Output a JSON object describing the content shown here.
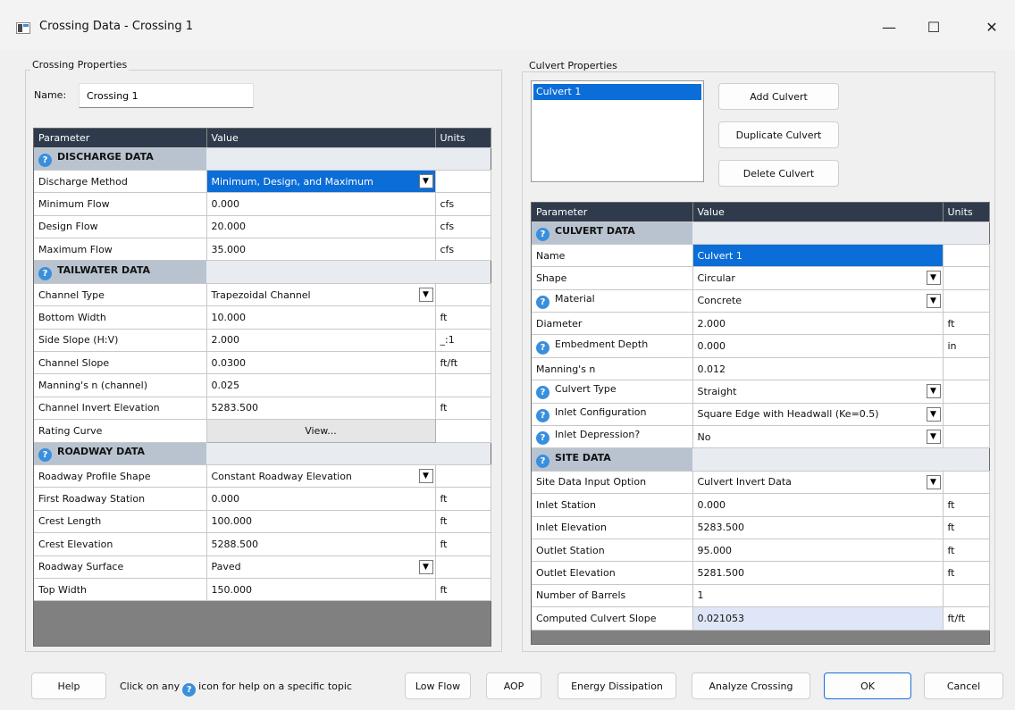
{
  "window": {
    "title": "Crossing Data - Crossing 1"
  },
  "crossing": {
    "group_label": "Crossing Properties",
    "name_label": "Name:",
    "name_value": "Crossing 1",
    "headers": [
      "Parameter",
      "Value",
      "Units"
    ],
    "sections": [
      {
        "title": "DISCHARGE DATA",
        "rows": [
          {
            "param": "Discharge Method",
            "value": "Minimum, Design, and Maximum",
            "units": ""
          },
          {
            "param": "Minimum Flow",
            "value": "0.000",
            "units": "cfs"
          },
          {
            "param": "Design Flow",
            "value": "20.000",
            "units": "cfs"
          },
          {
            "param": "Maximum Flow",
            "value": "35.000",
            "units": "cfs"
          }
        ]
      },
      {
        "title": "TAILWATER DATA",
        "rows": [
          {
            "param": "Channel Type",
            "value": "Trapezoidal Channel",
            "units": ""
          },
          {
            "param": "Bottom Width",
            "value": "10.000",
            "units": "ft"
          },
          {
            "param": "Side Slope (H:V)",
            "value": "2.000",
            "units": "_:1"
          },
          {
            "param": "Channel Slope",
            "value": "0.0300",
            "units": "ft/ft"
          },
          {
            "param": "Manning's n (channel)",
            "value": "0.025",
            "units": ""
          },
          {
            "param": "Channel Invert Elevation",
            "value": "5283.500",
            "units": "ft"
          },
          {
            "param": "Rating Curve",
            "value": "View...",
            "units": ""
          }
        ]
      },
      {
        "title": "ROADWAY DATA",
        "rows": [
          {
            "param": "Roadway Profile Shape",
            "value": "Constant Roadway Elevation",
            "units": ""
          },
          {
            "param": "First Roadway Station",
            "value": "0.000",
            "units": "ft"
          },
          {
            "param": "Crest Length",
            "value": "100.000",
            "units": "ft"
          },
          {
            "param": "Crest Elevation",
            "value": "5288.500",
            "units": "ft"
          },
          {
            "param": "Roadway Surface",
            "value": "Paved",
            "units": ""
          },
          {
            "param": "Top Width",
            "value": "150.000",
            "units": "ft"
          }
        ]
      }
    ]
  },
  "culvert": {
    "group_label": "Culvert Properties",
    "list": [
      "Culvert 1"
    ],
    "buttons": {
      "add": "Add Culvert",
      "duplicate": "Duplicate Culvert",
      "delete": "Delete Culvert"
    },
    "headers": [
      "Parameter",
      "Value",
      "Units"
    ],
    "sections": [
      {
        "title": "CULVERT DATA",
        "rows": [
          {
            "param": "Name",
            "value": "Culvert 1",
            "units": ""
          },
          {
            "param": "Shape",
            "value": "Circular",
            "units": ""
          },
          {
            "param": "Material",
            "value": "Concrete",
            "units": ""
          },
          {
            "param": "Diameter",
            "value": "2.000",
            "units": "ft"
          },
          {
            "param": "Embedment Depth",
            "value": "0.000",
            "units": "in"
          },
          {
            "param": "Manning's n",
            "value": "0.012",
            "units": ""
          },
          {
            "param": "Culvert Type",
            "value": "Straight",
            "units": ""
          },
          {
            "param": "Inlet Configuration",
            "value": "Square Edge with Headwall (Ke=0.5)",
            "units": ""
          },
          {
            "param": "Inlet Depression?",
            "value": "No",
            "units": ""
          }
        ]
      },
      {
        "title": "SITE DATA",
        "rows": [
          {
            "param": "Site Data Input Option",
            "value": "Culvert Invert Data",
            "units": ""
          },
          {
            "param": "Inlet Station",
            "value": "0.000",
            "units": "ft"
          },
          {
            "param": "Inlet Elevation",
            "value": "5283.500",
            "units": "ft"
          },
          {
            "param": "Outlet Station",
            "value": "95.000",
            "units": "ft"
          },
          {
            "param": "Outlet Elevation",
            "value": "5281.500",
            "units": "ft"
          },
          {
            "param": "Number of Barrels",
            "value": "1",
            "units": ""
          },
          {
            "param": "Computed Culvert Slope",
            "value": "0.021053",
            "units": "ft/ft"
          }
        ]
      }
    ]
  },
  "footer": {
    "help": "Help",
    "hint_before": "Click on any",
    "hint_after": "icon for help on a specific topic",
    "low_flow": "Low Flow",
    "aop": "AOP",
    "energy": "Energy Dissipation",
    "analyze": "Analyze Crossing",
    "ok": "OK",
    "cancel": "Cancel"
  },
  "colors": {
    "header_bg": "#2f3b4c",
    "section_bg": "#b9c3d0",
    "selection": "#0b6dd7",
    "help_icon": "#3a8fdc"
  }
}
